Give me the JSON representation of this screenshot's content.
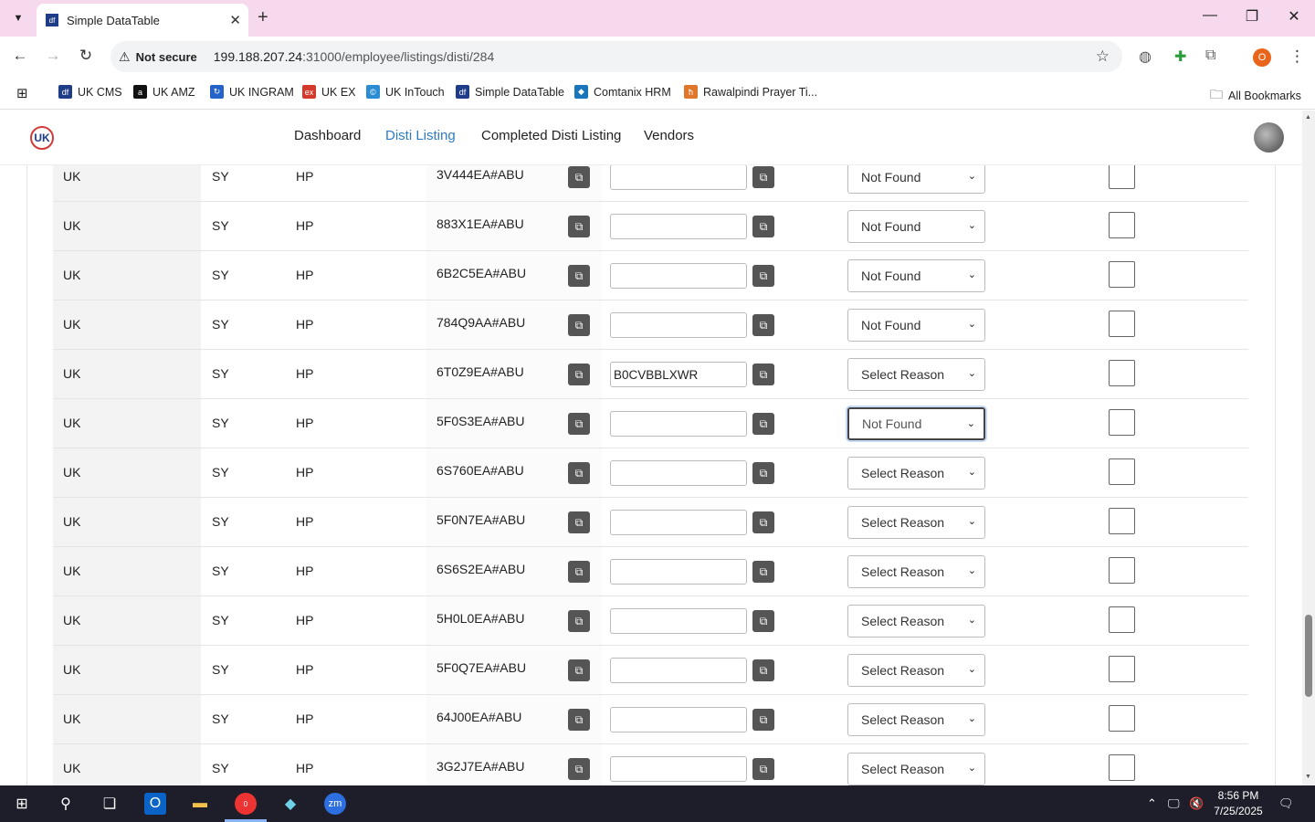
{
  "browser": {
    "tab_title": "Simple DataTable",
    "tab_favicon": "df",
    "new_tab": "+",
    "security_label": "Not secure",
    "url_host": "199.188.207.24",
    "url_path": ":31000/employee/listings/disti/284",
    "profile_initial": "O",
    "bookmarks": [
      {
        "label": "UK CMS",
        "icon": "df",
        "color": "#1f3c88"
      },
      {
        "label": "UK AMZ",
        "icon": "a",
        "color": "#111111"
      },
      {
        "label": "UK INGRAM",
        "icon": "↻",
        "color": "#2563c9"
      },
      {
        "label": "UK EX",
        "icon": "ex",
        "color": "#d33a2c"
      },
      {
        "label": "UK InTouch",
        "icon": "©",
        "color": "#2a8dd4"
      },
      {
        "label": "Simple DataTable",
        "icon": "df",
        "color": "#1f3c88"
      },
      {
        "label": "Comtanix HRM",
        "icon": "◆",
        "color": "#1a75bb"
      },
      {
        "label": "Rawalpindi Prayer Ti...",
        "icon": "ħ",
        "color": "#e0762b"
      }
    ],
    "all_bookmarks": "All Bookmarks"
  },
  "app": {
    "logo_text": "UK",
    "nav": [
      "Dashboard",
      "Disti Listing",
      "Completed Disti Listing",
      "Vendors"
    ],
    "active_nav": "Disti Listing"
  },
  "rows": [
    {
      "region": "UK",
      "vendor": "SY",
      "brand": "HP",
      "sku": "3V444EA#ABU",
      "asin": "",
      "reason": "Not Found"
    },
    {
      "region": "UK",
      "vendor": "SY",
      "brand": "HP",
      "sku": "883X1EA#ABU",
      "asin": "",
      "reason": "Not Found"
    },
    {
      "region": "UK",
      "vendor": "SY",
      "brand": "HP",
      "sku": "6B2C5EA#ABU",
      "asin": "",
      "reason": "Not Found"
    },
    {
      "region": "UK",
      "vendor": "SY",
      "brand": "HP",
      "sku": "784Q9AA#ABU",
      "asin": "",
      "reason": "Not Found"
    },
    {
      "region": "UK",
      "vendor": "SY",
      "brand": "HP",
      "sku": "6T0Z9EA#ABU",
      "asin": "B0CVBBLXWR",
      "reason": "Select Reason"
    },
    {
      "region": "UK",
      "vendor": "SY",
      "brand": "HP",
      "sku": "5F0S3EA#ABU",
      "asin": "",
      "reason": "Not Found"
    },
    {
      "region": "UK",
      "vendor": "SY",
      "brand": "HP",
      "sku": "6S760EA#ABU",
      "asin": "",
      "reason": "Select Reason"
    },
    {
      "region": "UK",
      "vendor": "SY",
      "brand": "HP",
      "sku": "5F0N7EA#ABU",
      "asin": "",
      "reason": "Select Reason"
    },
    {
      "region": "UK",
      "vendor": "SY",
      "brand": "HP",
      "sku": "6S6S2EA#ABU",
      "asin": "",
      "reason": "Select Reason"
    },
    {
      "region": "UK",
      "vendor": "SY",
      "brand": "HP",
      "sku": "5H0L0EA#ABU",
      "asin": "",
      "reason": "Select Reason"
    },
    {
      "region": "UK",
      "vendor": "SY",
      "brand": "HP",
      "sku": "5F0Q7EA#ABU",
      "asin": "",
      "reason": "Select Reason"
    },
    {
      "region": "UK",
      "vendor": "SY",
      "brand": "HP",
      "sku": "64J00EA#ABU",
      "asin": "",
      "reason": "Select Reason"
    },
    {
      "region": "UK",
      "vendor": "SY",
      "brand": "HP",
      "sku": "3G2J7EA#ABU",
      "asin": "",
      "reason": "Select Reason"
    }
  ],
  "taskbar": {
    "time": "8:56 PM",
    "date": "7/25/2025",
    "chrome_badge": "0"
  }
}
